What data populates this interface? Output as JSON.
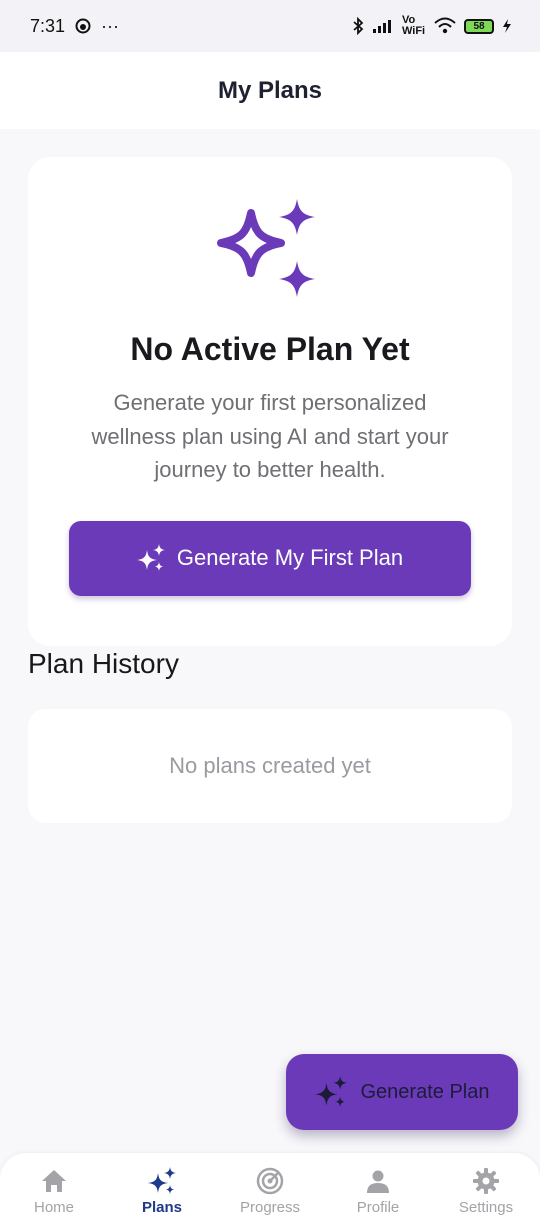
{
  "status": {
    "time": "7:31",
    "dots": "···",
    "network": "Vo WiFi",
    "battery": "58"
  },
  "header": {
    "title": "My Plans"
  },
  "empty_state": {
    "icon": "sparkles-icon",
    "title": "No Active Plan Yet",
    "description": "Generate your first personalized wellness plan using AI and start your journey to better health.",
    "button_label": "Generate My First Plan"
  },
  "history": {
    "title": "Plan History",
    "empty_text": "No plans created yet"
  },
  "fab": {
    "label": "Generate Plan",
    "icon": "sparkles-icon"
  },
  "nav": {
    "items": [
      {
        "label": "Home",
        "icon": "home-icon",
        "active": false
      },
      {
        "label": "Plans",
        "icon": "sparkles-icon",
        "active": true
      },
      {
        "label": "Progress",
        "icon": "radar-icon",
        "active": false
      },
      {
        "label": "Profile",
        "icon": "person-icon",
        "active": false
      },
      {
        "label": "Settings",
        "icon": "gear-icon",
        "active": false
      }
    ]
  },
  "colors": {
    "accent": "#6b3ab8",
    "nav_active": "#1e3a8a",
    "nav_inactive": "#a3a3a8"
  }
}
